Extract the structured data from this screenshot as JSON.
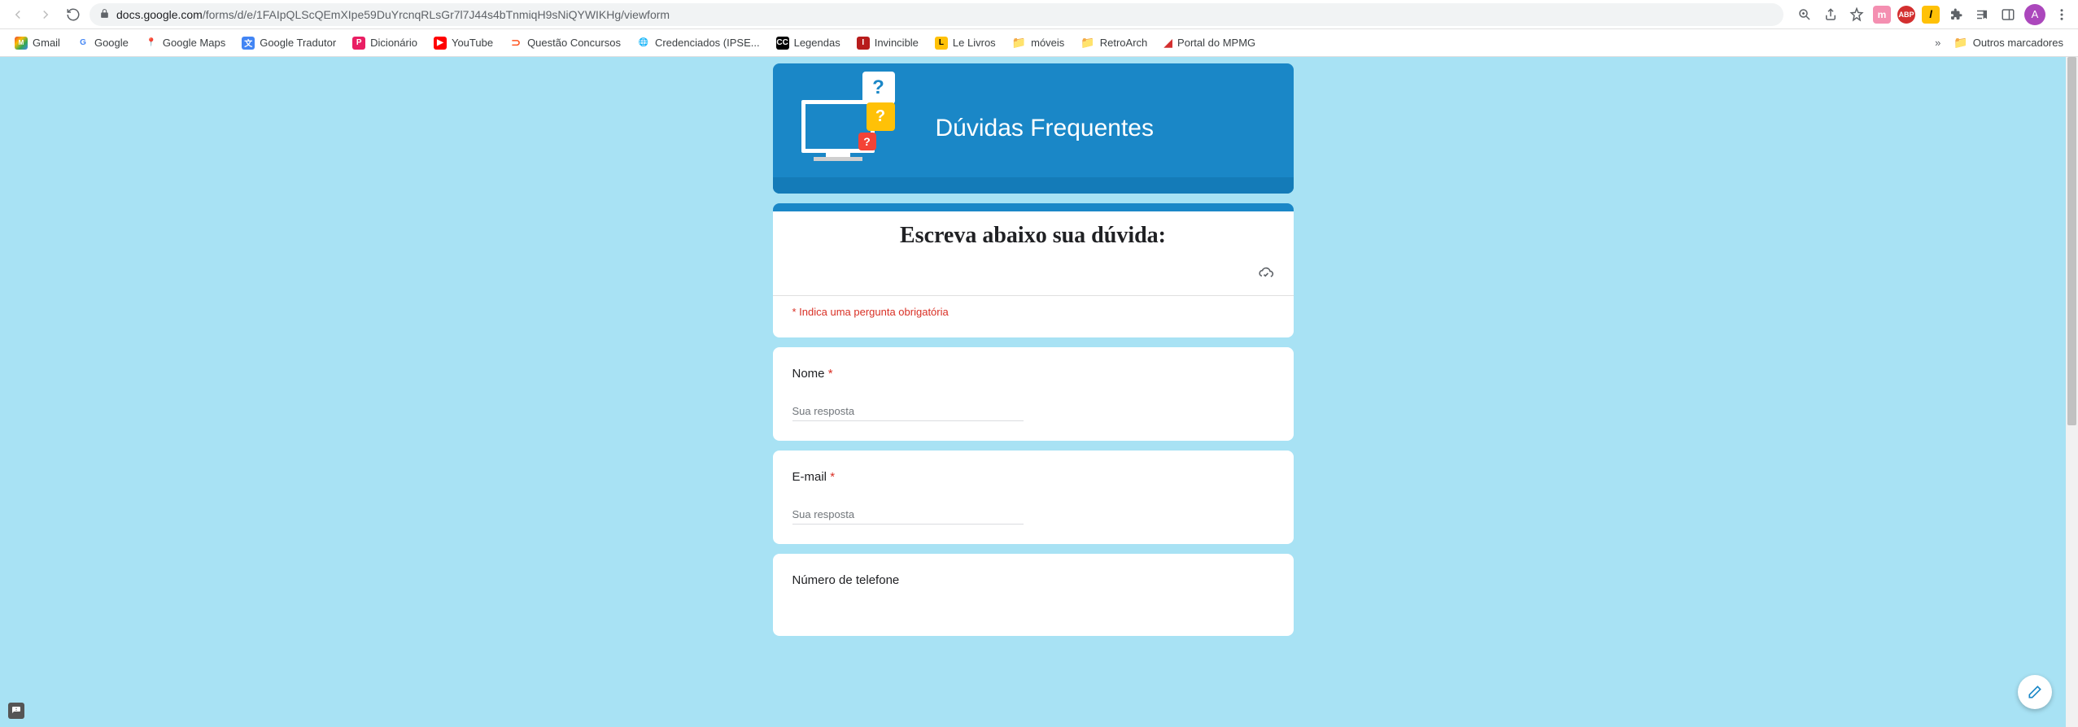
{
  "browser": {
    "url_domain": "docs.google.com",
    "url_path": "/forms/d/e/1FAIpQLScQEmXIpe59DuYrcnqRLsGr7l7J44s4bTnmiqH9sNiQYWIKHg/viewform",
    "avatar_letter": "A",
    "ext_m": "m",
    "ext_abp": "ABP",
    "ext_y": "l"
  },
  "bookmarks": {
    "gmail": "Gmail",
    "google": "Google",
    "maps": "Google Maps",
    "tradutor": "Google Tradutor",
    "dicionario": "Dicionário",
    "youtube": "YouTube",
    "questao": "Questão Concursos",
    "credenciados": "Credenciados (IPSE...",
    "legendas": "Legendas",
    "invincible": "Invincible",
    "lelivros": "Le Livros",
    "moveis": "móveis",
    "retroarch": "RetroArch",
    "portal": "Portal do MPMG",
    "overflow": "»",
    "outros": "Outros marcadores"
  },
  "form": {
    "banner_title": "Dúvidas Frequentes",
    "title": "Escreva abaixo sua dúvida:",
    "required_note": "* Indica uma pergunta obrigatória",
    "q_nome": "Nome",
    "q_email": "E-mail",
    "q_telefone": "Número de telefone",
    "asterisk": "*",
    "placeholder": "Sua resposta"
  }
}
